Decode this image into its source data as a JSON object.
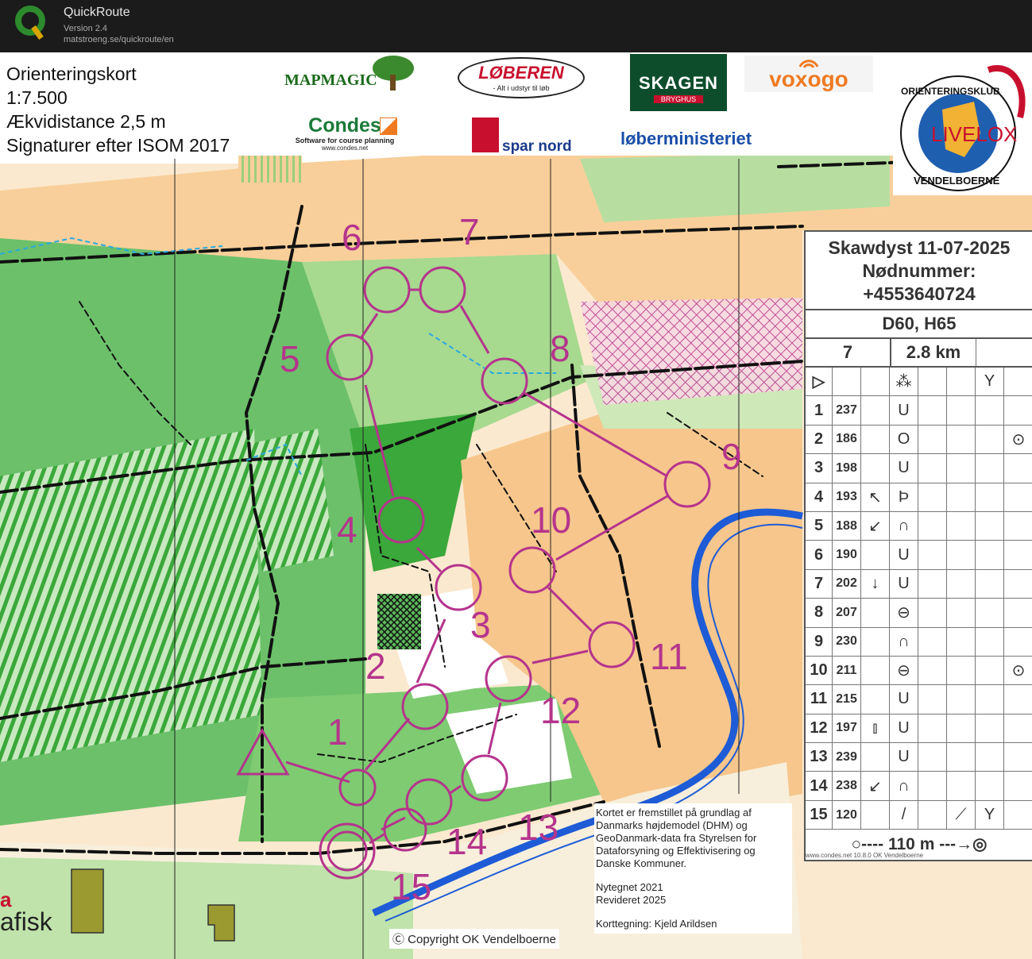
{
  "app": {
    "name": "QuickRoute",
    "version": "Version 2.4",
    "url": "matstroeng.se/quickroute/en"
  },
  "map_info": {
    "line1": "Orienteringskort",
    "line2": "1:7.500",
    "line3": "Ækvidistance 2,5 m",
    "line4": "Signaturer efter ISOM 2017"
  },
  "sponsors": {
    "mapmagic": "MAPMAGIC",
    "loberen": "LØBEREN",
    "loberen_sub": "- Alt i udstyr til løb",
    "skagen": "SKAGEN",
    "skagen_sub": "BRYGHUS",
    "voxogo": "voxogo",
    "condes": "Condes",
    "condes_sub": "Software for course planning",
    "condes_url": "www.condes.net",
    "sparnord": "spar nord",
    "loberministeriet": "løberministeriet",
    "club_top": "ORIENTERINGSKLUB",
    "club_bottom": "VENDELBOERNE",
    "livelox": "LIVELOX",
    "grafisk": "afisk",
    "grafisk_a": "a"
  },
  "control_table": {
    "event": "Skawdyst 11-07-2025",
    "emergency_label": "Nødnummer:",
    "emergency_number": "+4553640724",
    "course": "D60, H65",
    "controls_count": "7",
    "length": "2.8 km",
    "controls": [
      {
        "num": "1",
        "code": "237",
        "dir": "",
        "feature": "U"
      },
      {
        "num": "2",
        "code": "186",
        "dir": "",
        "feature": "O",
        "extra": "⊙"
      },
      {
        "num": "3",
        "code": "198",
        "dir": "",
        "feature": "U"
      },
      {
        "num": "4",
        "code": "193",
        "dir": "↖",
        "feature": "Þ"
      },
      {
        "num": "5",
        "code": "188",
        "dir": "↙",
        "feature": "∩"
      },
      {
        "num": "6",
        "code": "190",
        "dir": "",
        "feature": "U"
      },
      {
        "num": "7",
        "code": "202",
        "dir": "↓",
        "feature": "U"
      },
      {
        "num": "8",
        "code": "207",
        "dir": "",
        "feature": "⊖"
      },
      {
        "num": "9",
        "code": "230",
        "dir": "",
        "feature": "∩"
      },
      {
        "num": "10",
        "code": "211",
        "dir": "",
        "feature": "⊖",
        "extra": "⊙"
      },
      {
        "num": "11",
        "code": "215",
        "dir": "",
        "feature": "U"
      },
      {
        "num": "12",
        "code": "197",
        "dir": "⫾",
        "feature": "U"
      },
      {
        "num": "13",
        "code": "239",
        "dir": "",
        "feature": "U"
      },
      {
        "num": "14",
        "code": "238",
        "dir": "↙",
        "feature": "∩"
      },
      {
        "num": "15",
        "code": "120",
        "dir": "",
        "feature": "/",
        "extra": "⟋",
        "extra2": "Y"
      }
    ],
    "finish": "○---- 110 m ---→◎",
    "condes_version": "www.condes.net 10.8.0 OK Vendelboerne"
  },
  "credits": {
    "text1": "Kortet er fremstillet på grundlag af Danmarks højdemodel (DHM) og GeoDanmark-data fra Styrelsen for Dataforsyning og Effektivisering og Danske Kommuner.",
    "text2": "Nytegnet 2021",
    "text3": "Revideret 2025",
    "text4": "Korttegning: Kjeld Arildsen",
    "copyright": "Ⓒ Copyright OK Vendelboerne"
  },
  "course_labels": [
    "1",
    "2",
    "3",
    "4",
    "5",
    "6",
    "7",
    "8",
    "9",
    "10",
    "11",
    "12",
    "13",
    "14",
    "15"
  ],
  "colors": {
    "course": "#b5348c",
    "open": "#f8cf9a",
    "forest": "#5cb85c",
    "dark_forest": "#2e9e3a",
    "water": "#1e5bd6",
    "paths": "#111111",
    "contours": "#b86c1c"
  }
}
